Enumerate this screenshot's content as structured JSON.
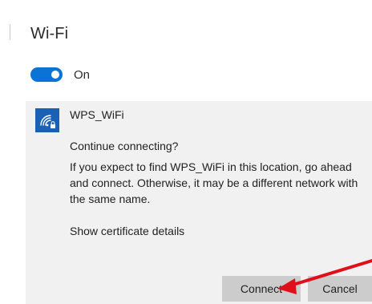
{
  "header": {
    "title": "Wi-Fi"
  },
  "toggle": {
    "state": "On",
    "on": true,
    "color": "#0a73d6"
  },
  "network": {
    "name": "WPS_WiFi",
    "icon": "wifi-secure-icon",
    "icon_bg": "#1a60b4",
    "prompt": "Continue connecting?",
    "message": "If you expect to find WPS_WiFi in this location, go ahead and connect. Otherwise, it may be a different network with the same name.",
    "certificate_link": "Show certificate details"
  },
  "buttons": {
    "connect": "Connect",
    "cancel": "Cancel"
  },
  "annotation": {
    "icon": "red-arrow",
    "color": "#e0101a"
  }
}
